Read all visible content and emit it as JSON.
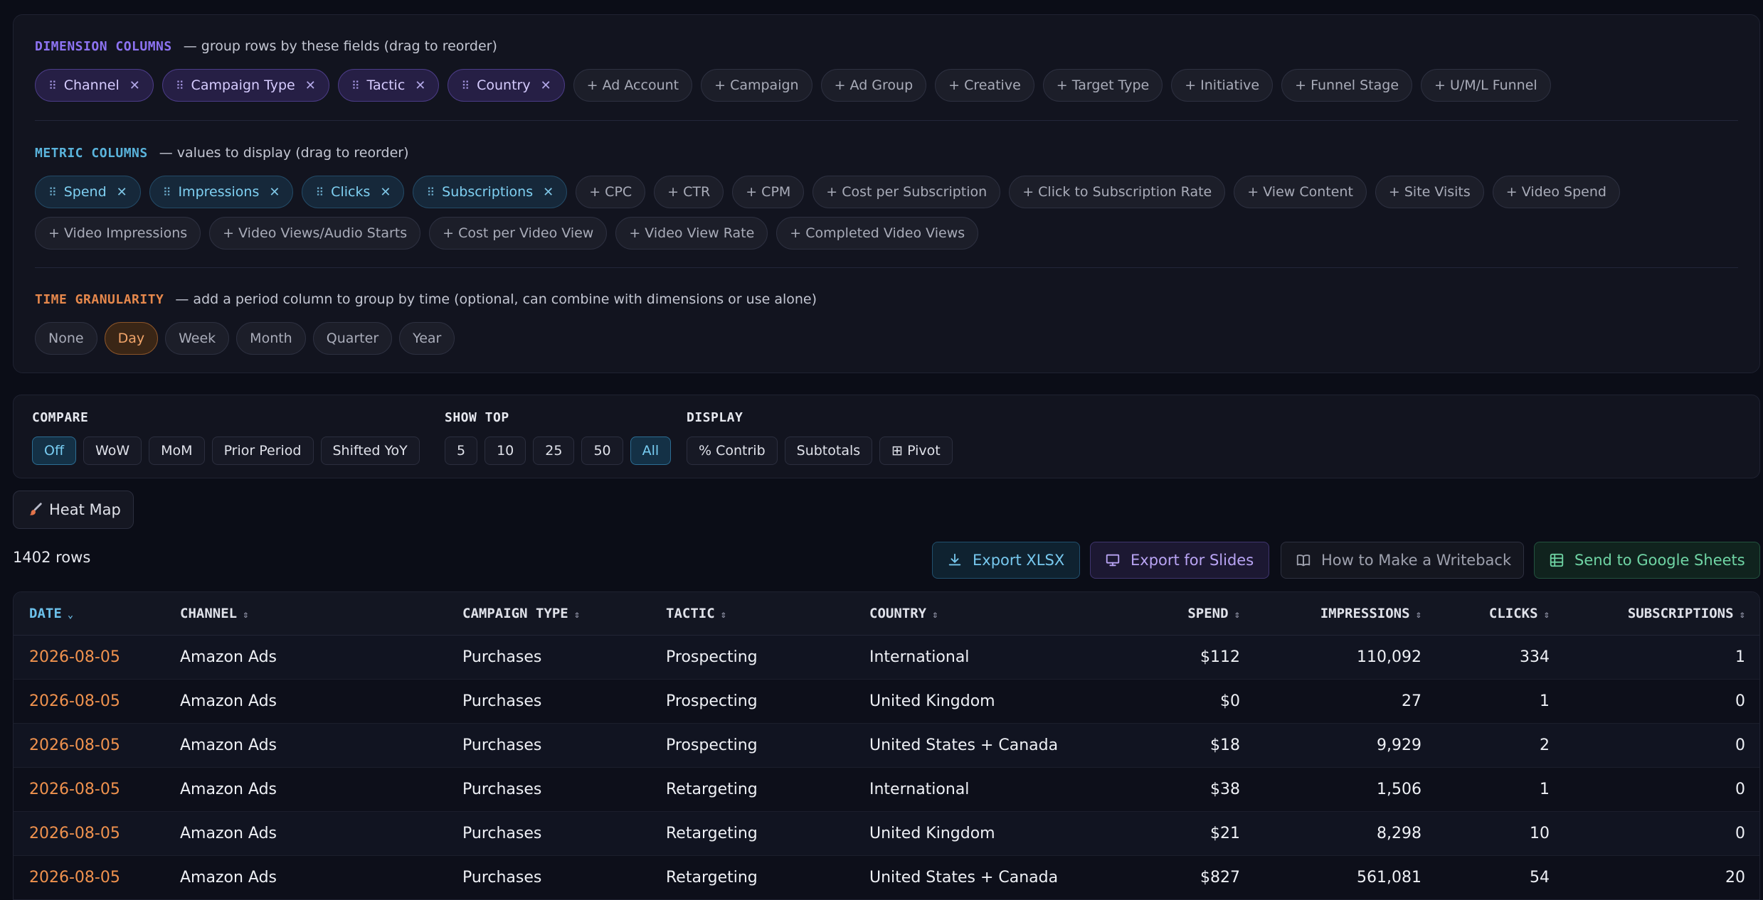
{
  "dimension": {
    "title": "DIMENSION COLUMNS",
    "hint": "— group rows by these fields (drag to reorder)",
    "selected": [
      "Channel",
      "Campaign Type",
      "Tactic",
      "Country"
    ],
    "available": [
      "+ Ad Account",
      "+ Campaign",
      "+ Ad Group",
      "+ Creative",
      "+ Target Type",
      "+ Initiative",
      "+ Funnel Stage",
      "+ U/M/L Funnel"
    ]
  },
  "metric": {
    "title": "METRIC COLUMNS",
    "hint": "— values to display (drag to reorder)",
    "selected": [
      "Spend",
      "Impressions",
      "Clicks",
      "Subscriptions"
    ],
    "available": [
      "+ CPC",
      "+ CTR",
      "+ CPM",
      "+ Cost per Subscription",
      "+ Click to Subscription Rate",
      "+ View Content",
      "+ Site Visits",
      "+ Video Spend",
      "+ Video Impressions",
      "+ Video Views/Audio Starts",
      "+ Cost per Video View",
      "+ Video View Rate",
      "+ Completed Video Views"
    ]
  },
  "time": {
    "title": "TIME GRANULARITY",
    "hint": "— add a period column to group by time (optional, can combine with dimensions or use alone)",
    "options": [
      "None",
      "Day",
      "Week",
      "Month",
      "Quarter",
      "Year"
    ],
    "active": "Day"
  },
  "compare": {
    "label": "COMPARE",
    "options": [
      "Off",
      "WoW",
      "MoM",
      "Prior Period",
      "Shifted YoY"
    ],
    "active": "Off"
  },
  "show_top": {
    "label": "SHOW TOP",
    "options": [
      "5",
      "10",
      "25",
      "50",
      "All"
    ],
    "active": "All"
  },
  "display": {
    "label": "DISPLAY",
    "options": [
      "% Contrib",
      "Subtotals",
      "⊞ Pivot"
    ]
  },
  "heatmap_label": "Heat Map",
  "row_count": "1402 rows",
  "actions": {
    "export_xlsx": "Export XLSX",
    "export_slides": "Export for Slides",
    "writeback": "How to Make a Writeback",
    "google_sheets": "Send to Google Sheets"
  },
  "table": {
    "columns": [
      "DATE",
      "CHANNEL",
      "CAMPAIGN TYPE",
      "TACTIC",
      "COUNTRY",
      "SPEND",
      "IMPRESSIONS",
      "CLICKS",
      "SUBSCRIPTIONS"
    ],
    "rows": [
      [
        "2026-08-05",
        "Amazon Ads",
        "Purchases",
        "Prospecting",
        "International",
        "$112",
        "110,092",
        "334",
        "1"
      ],
      [
        "2026-08-05",
        "Amazon Ads",
        "Purchases",
        "Prospecting",
        "United Kingdom",
        "$0",
        "27",
        "1",
        "0"
      ],
      [
        "2026-08-05",
        "Amazon Ads",
        "Purchases",
        "Prospecting",
        "United States + Canada",
        "$18",
        "9,929",
        "2",
        "0"
      ],
      [
        "2026-08-05",
        "Amazon Ads",
        "Purchases",
        "Retargeting",
        "International",
        "$38",
        "1,506",
        "1",
        "0"
      ],
      [
        "2026-08-05",
        "Amazon Ads",
        "Purchases",
        "Retargeting",
        "United Kingdom",
        "$21",
        "8,298",
        "10",
        "0"
      ],
      [
        "2026-08-05",
        "Amazon Ads",
        "Purchases",
        "Retargeting",
        "United States + Canada",
        "$827",
        "561,081",
        "54",
        "20"
      ]
    ]
  },
  "colors": {
    "dimension_accent": "#8d73f2",
    "metric_accent": "#5ab4dc",
    "time_accent": "#e6884c",
    "date_text": "#f0924e"
  }
}
